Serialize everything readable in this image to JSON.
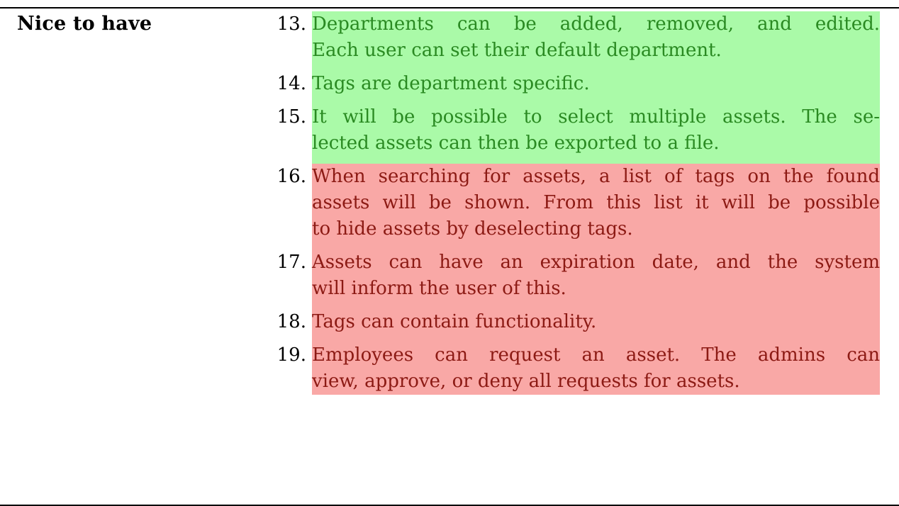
{
  "section": {
    "heading": "Nice to have"
  },
  "requirements": [
    {
      "number": "13.",
      "status": "green",
      "lines": [
        "Departments can be added, removed, and edited.",
        "Each user can set their default department."
      ]
    },
    {
      "number": "14.",
      "status": "green",
      "lines": [
        "Tags are department specific."
      ]
    },
    {
      "number": "15.",
      "status": "green",
      "lines": [
        "It will be possible to select multiple assets. The se-",
        "lected assets can then be exported to a file."
      ]
    },
    {
      "number": "16.",
      "status": "red",
      "lines": [
        "When searching for assets, a list of tags on the found",
        "assets will be shown. From this list it will be possible",
        "to hide assets by deselecting tags."
      ]
    },
    {
      "number": "17.",
      "status": "red",
      "lines": [
        "Assets can have an expiration date, and the system",
        "will inform the user of this."
      ]
    },
    {
      "number": "18.",
      "status": "red",
      "lines": [
        "Tags can contain functionality."
      ]
    },
    {
      "number": "19.",
      "status": "red",
      "lines": [
        "Employees can request an asset.  The admins can",
        "view, approve, or deny all requests for assets."
      ]
    }
  ],
  "colors": {
    "green_bg": "#aafaa8",
    "green_text": "#2a8a22",
    "red_bg": "#f9a8a6",
    "red_text": "#8c1a14"
  }
}
